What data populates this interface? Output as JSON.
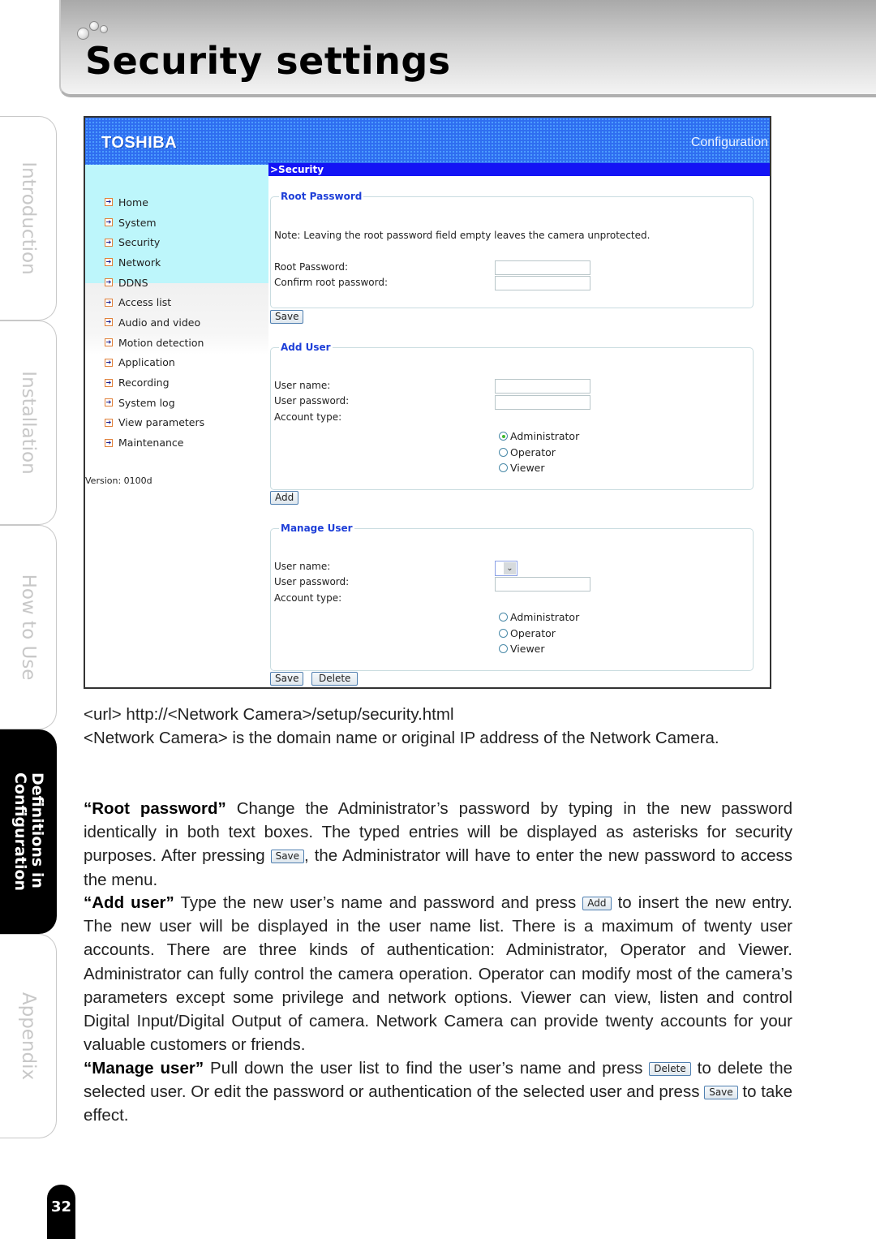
{
  "page": {
    "title": "Security settings",
    "page_number": "32"
  },
  "side_tabs": [
    {
      "label": "Introduction",
      "active": false
    },
    {
      "label": "Installation",
      "active": false
    },
    {
      "label": "How to Use",
      "active": false
    },
    {
      "label_line1": "Definitions in",
      "label_line2": "Configuration",
      "active": true
    },
    {
      "label": "Appendix",
      "active": false
    }
  ],
  "screenshot": {
    "brand": "TOSHIBA",
    "header_right": "Configuration",
    "breadcrumb": ">Security",
    "colors": {
      "header_blue": "#2f6ef0",
      "breadcrumb_blue": "#1414f5",
      "sidebar_cyan": "#bdf6fb",
      "legend_blue": "#1e3fd8"
    },
    "nav": [
      {
        "label": "Home",
        "icon": "arrow-right-icon"
      },
      {
        "label": "System",
        "icon": "arrow-right-icon"
      },
      {
        "label": "Security",
        "icon": "arrow-right-icon"
      },
      {
        "label": "Network",
        "icon": "arrow-right-icon"
      },
      {
        "label": "DDNS",
        "icon": "arrow-right-icon"
      },
      {
        "label": "Access list",
        "icon": "arrow-right-icon"
      },
      {
        "label": "Audio and video",
        "icon": "arrow-right-icon"
      },
      {
        "label": "Motion detection",
        "icon": "arrow-right-icon"
      },
      {
        "label": "Application",
        "icon": "arrow-right-icon"
      },
      {
        "label": "Recording",
        "icon": "arrow-right-icon"
      },
      {
        "label": "System log",
        "icon": "arrow-right-icon"
      },
      {
        "label": "View parameters",
        "icon": "arrow-right-icon"
      },
      {
        "label": "Maintenance",
        "icon": "arrow-right-icon"
      }
    ],
    "version": "Version: 0100d",
    "root_password": {
      "legend": "Root Password",
      "note": "Note: Leaving the root password field empty leaves the camera unprotected.",
      "root_password_label": "Root Password:",
      "root_password_value": "",
      "confirm_label": "Confirm root password:",
      "confirm_value": "",
      "save_button": "Save"
    },
    "add_user": {
      "legend": "Add User",
      "user_name_label": "User name:",
      "user_name_value": "",
      "user_password_label": "User password:",
      "user_password_value": "",
      "account_type_label": "Account type:",
      "account_types": [
        "Administrator",
        "Operator",
        "Viewer"
      ],
      "selected_account_type": "Administrator",
      "add_button": "Add"
    },
    "manage_user": {
      "legend": "Manage User",
      "user_name_label": "User name:",
      "user_name_selected": "",
      "user_password_label": "User password:",
      "user_password_value": "",
      "account_type_label": "Account type:",
      "account_types": [
        "Administrator",
        "Operator",
        "Viewer"
      ],
      "selected_account_type": null,
      "save_button": "Save",
      "delete_button": "Delete"
    }
  },
  "description": {
    "url_line": "<url> http://<Network Camera>/setup/security.html",
    "network_camera_line": "<Network Camera> is the domain name or original IP address of the Network Camera.",
    "root_password": {
      "term": "“Root password”",
      "text_before": " Change the Administrator’s password by typing in the new password identically in both text boxes. The typed entries will be displayed as asterisks for security purposes. After pressing ",
      "inline_button": "Save",
      "text_after": ", the Administrator will have to enter the new password to access the menu."
    },
    "add_user": {
      "term": "“Add user”",
      "text_before": " Type the new user’s name and password and press ",
      "inline_button": "Add",
      "text_after": " to insert the new entry. The new user will be displayed in the user name list. There is a maximum of twenty user accounts. There are three kinds of authentication: Administrator, Operator and Viewer. Administrator can fully control the camera operation. Operator can modify most of the camera’s parameters except some privilege and network options. Viewer can view, listen and control Digital Input/Digital Output of camera. Network Camera can provide twenty accounts for your valuable customers or friends."
    },
    "manage_user": {
      "term": "“Manage user”",
      "text_before": " Pull down the user list to find the user’s name and press ",
      "inline_button_1": "Delete",
      "text_middle": " to delete the selected user. Or edit the password or authentication of the selected user and press ",
      "inline_button_2": "Save",
      "text_after": " to take effect."
    }
  }
}
